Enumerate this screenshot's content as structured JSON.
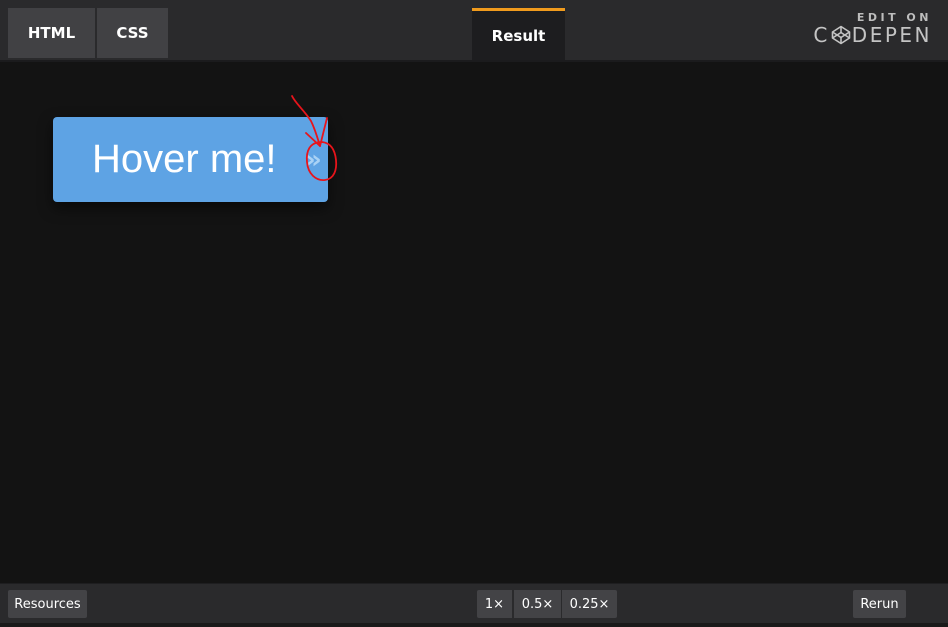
{
  "header": {
    "tabs": [
      {
        "label": "HTML",
        "active": false
      },
      {
        "label": "CSS",
        "active": false
      },
      {
        "label": "Result",
        "active": true
      }
    ],
    "logo": {
      "edit_on": "EDIT ON",
      "word_left": "C",
      "word_right": "DEPEN"
    }
  },
  "result": {
    "button_label": "Hover me!",
    "button_arrow": "»"
  },
  "footer": {
    "resources_label": "Resources",
    "zoom_options": [
      "1×",
      "0.5×",
      "0.25×"
    ],
    "rerun_label": "Rerun"
  },
  "colors": {
    "accent": "#f09b1d",
    "button": "#5ea3e4",
    "annotation": "#e8141b"
  },
  "icons": {
    "logo": "codepen-cube-icon",
    "annotation": "red-arrow-circle-annotation"
  }
}
